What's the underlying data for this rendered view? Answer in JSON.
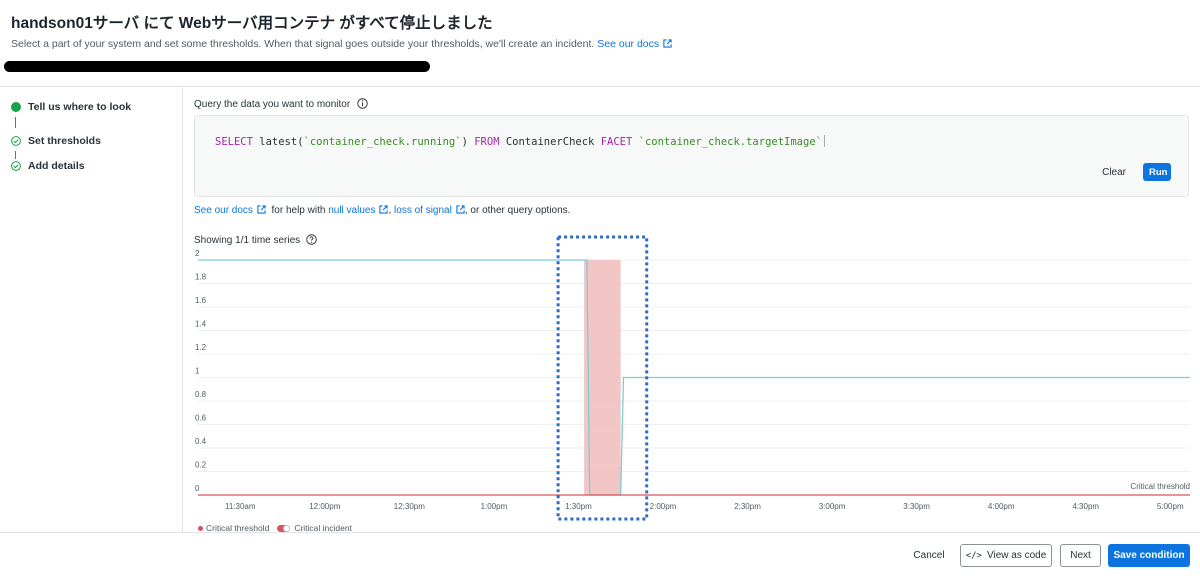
{
  "header": {
    "title": "handson01サーバ にて Webサーバ用コンテナ がすべて停止しました",
    "subtitle": "Select a part of your system and set some thresholds. When that signal goes outside your thresholds, we'll create an incident.",
    "docs_link": "See our docs"
  },
  "sidebar": {
    "steps": [
      {
        "label": "Tell us where to look",
        "state": "active"
      },
      {
        "label": "Set thresholds",
        "state": "done"
      },
      {
        "label": "Add details",
        "state": "done"
      }
    ]
  },
  "query": {
    "label": "Query the data you want to monitor",
    "text": {
      "select": "SELECT",
      "func": "latest(",
      "arg": "`container_check.running`",
      "close": ")",
      "from": "FROM",
      "table": "ContainerCheck",
      "facet": "FACET",
      "facet_arg": "`container_check.targetImage`"
    },
    "clear_label": "Clear",
    "run_label": "Run"
  },
  "help": {
    "docs_link": "See our docs",
    "for_help": "for help with",
    "null_values": "null values",
    "comma": ",",
    "loss_of_signal": "loss of signal",
    "tail": ", or other query options."
  },
  "chart": {
    "showing_label": "Showing 1/1 time series",
    "threshold_label": "Critical threshold",
    "legend": {
      "critical_threshold": "Critical threshold",
      "critical_incident": "Critical incident"
    }
  },
  "chart_data": {
    "type": "line",
    "ylim": [
      0,
      2
    ],
    "yticks": [
      "0",
      "0.2",
      "0.4",
      "0.6",
      "0.8",
      "1",
      "1.2",
      "1.4",
      "1.6",
      "1.8",
      "2"
    ],
    "xticks": [
      "11:30am",
      "12:00pm",
      "12:30pm",
      "1:00pm",
      "1:30pm",
      "2:00pm",
      "2:30pm",
      "3:00pm",
      "3:30pm",
      "4:00pm",
      "4:30pm",
      "5:00pm"
    ],
    "series": [
      {
        "points": [
          [
            "11:15am",
            2
          ],
          [
            "1:33pm",
            2
          ],
          [
            "1:34pm",
            0
          ],
          [
            "1:45pm",
            0
          ],
          [
            "1:46pm",
            1
          ],
          [
            "5:07pm",
            1
          ]
        ]
      }
    ],
    "threshold": {
      "label": "Critical threshold",
      "value": 0
    },
    "incident": {
      "start": "1:32pm",
      "end": "1:45pm"
    },
    "colors": {
      "line": "#79cfd6",
      "incident": "#f1bcbc",
      "threshold": "#d9525e",
      "highlight": "#2e6bc6"
    }
  },
  "footer": {
    "cancel": "Cancel",
    "view_code": "View as code",
    "next": "Next",
    "save": "Save condition"
  }
}
